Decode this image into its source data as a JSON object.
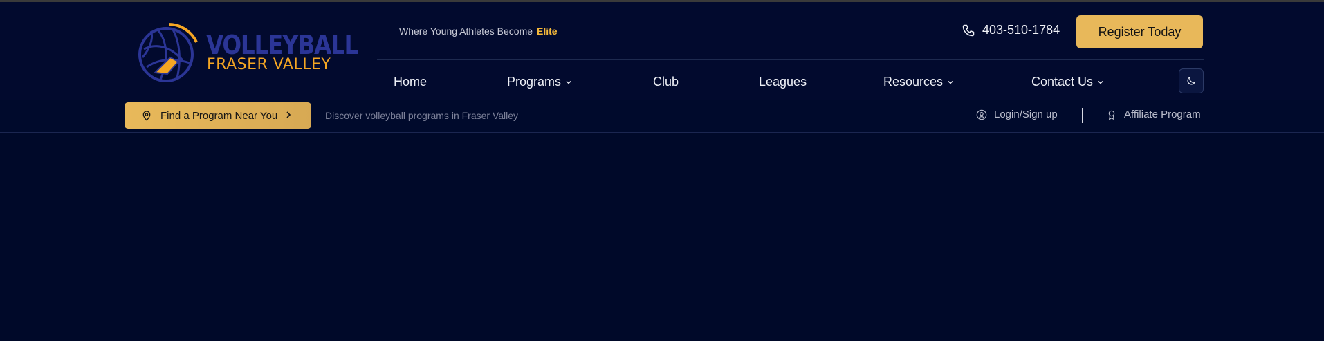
{
  "brand": {
    "name_line1": "VOLLEYBALL",
    "name_line2": "FRASER VALLEY",
    "colors": {
      "primary": "#2b3596",
      "accent": "#f5a623"
    }
  },
  "header": {
    "tagline": "Where Young Athletes Become",
    "tagline_highlight": "Elite",
    "phone": "403-510-1784",
    "register_label": "Register Today"
  },
  "nav": {
    "items": [
      {
        "label": "Home",
        "has_dropdown": false
      },
      {
        "label": "Programs",
        "has_dropdown": true
      },
      {
        "label": "Club",
        "has_dropdown": false
      },
      {
        "label": "Leagues",
        "has_dropdown": false
      },
      {
        "label": "Resources",
        "has_dropdown": true
      },
      {
        "label": "Contact Us",
        "has_dropdown": true
      }
    ],
    "theme_toggle_icon": "moon-icon"
  },
  "subbar": {
    "find_label": "Find a Program Near You",
    "discover_text": "Discover volleyball programs in Fraser Valley",
    "login_label": "Login/Sign up",
    "affiliate_label": "Affiliate Program"
  },
  "theme": {
    "background": "#000929",
    "button_gold": "#e8b85a",
    "highlight_gold": "#f5b93b"
  }
}
